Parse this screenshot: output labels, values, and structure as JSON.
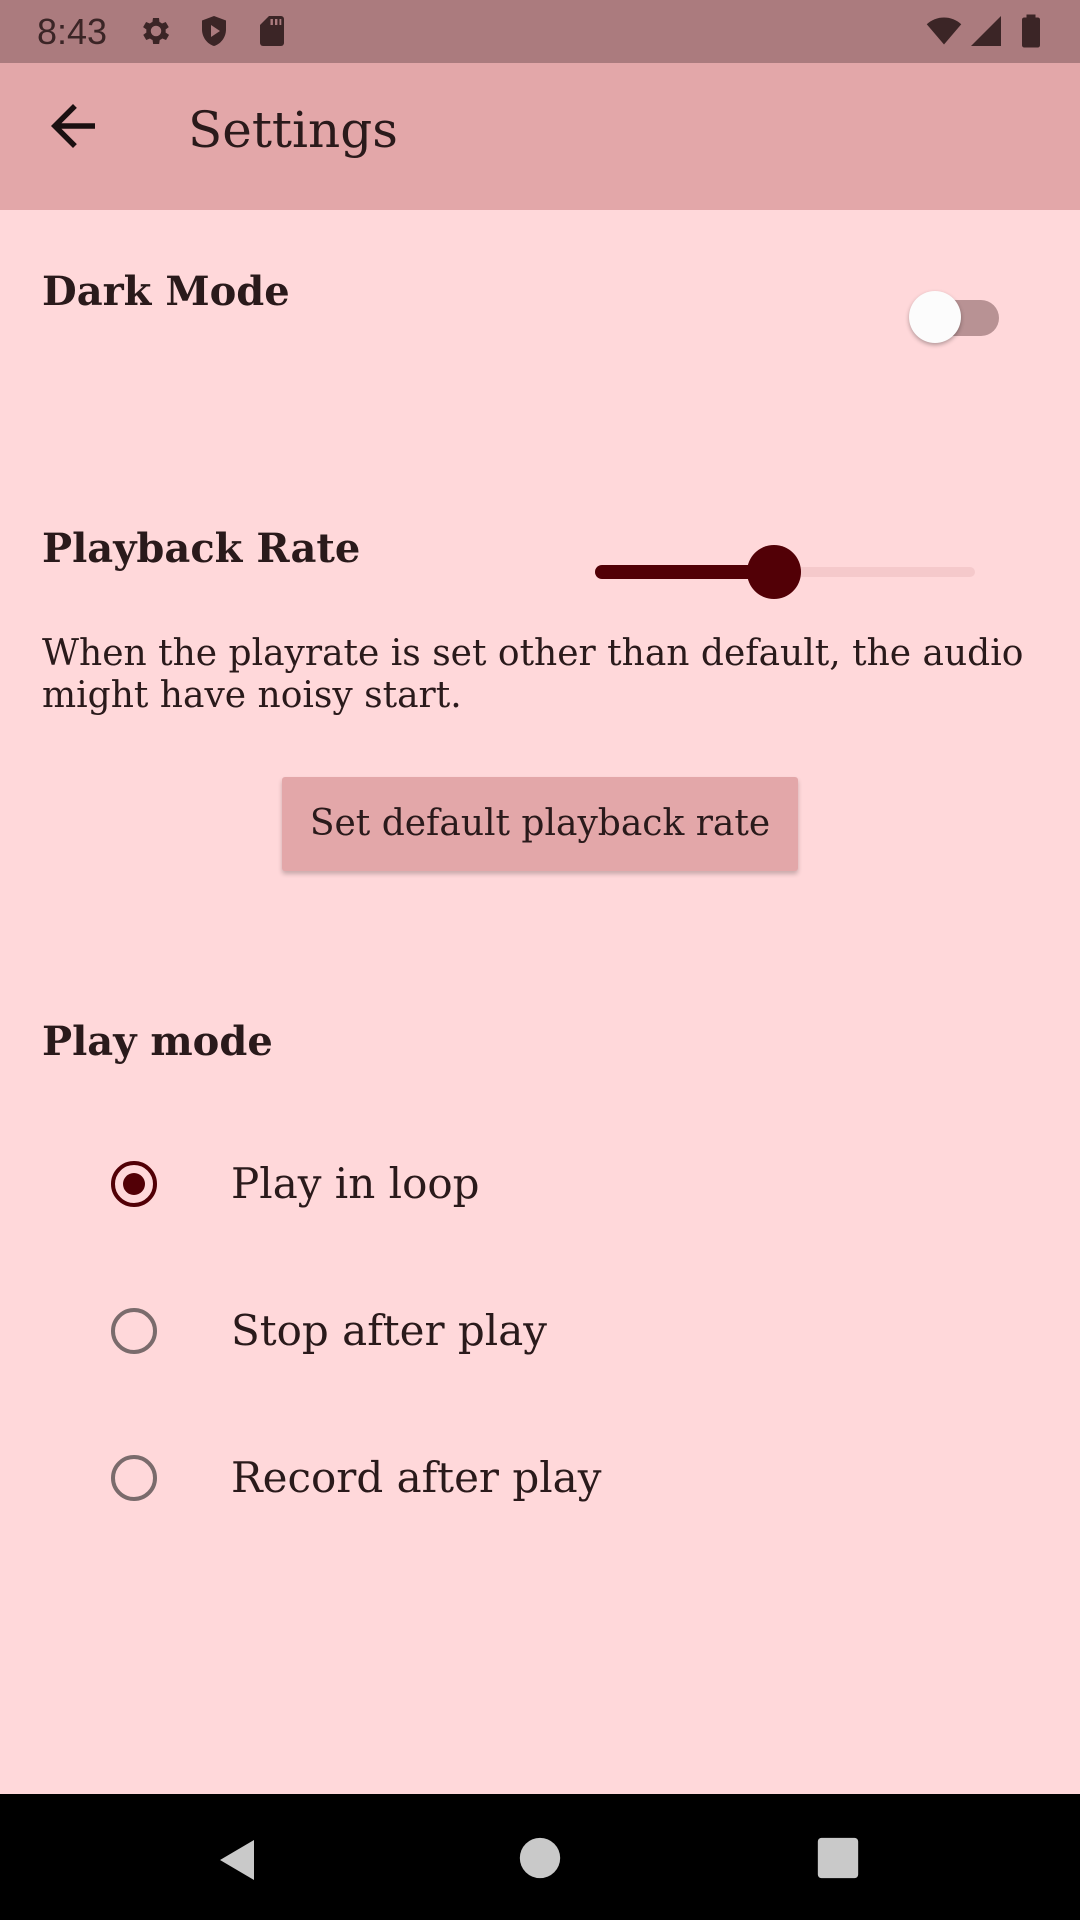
{
  "status_bar": {
    "time": "8:43",
    "left_icons": [
      "gear-icon",
      "shield-icon",
      "sd-card-icon"
    ],
    "right_icons": [
      "wifi-icon",
      "signal-icon",
      "battery-icon"
    ]
  },
  "app_bar": {
    "title": "Settings",
    "back_icon": "arrow-left-icon"
  },
  "dark_mode": {
    "label": "Dark Mode",
    "enabled": false
  },
  "playback_rate": {
    "label": "Playback Rate",
    "slider_fraction": 0.47,
    "note": "When the playrate is set other than default, the audio might have noisy start.",
    "reset_button": "Set default playback rate"
  },
  "play_mode": {
    "label": "Play mode",
    "options": [
      {
        "label": "Play in loop",
        "selected": true
      },
      {
        "label": "Stop after play",
        "selected": false
      },
      {
        "label": "Record after play",
        "selected": false
      }
    ]
  },
  "nav_bar": {
    "icons": [
      "back-triangle-icon",
      "home-circle-icon",
      "recents-square-icon"
    ]
  },
  "colors": {
    "background": "#ffd8da",
    "app_bar": "#e3a7a9",
    "status_bar": "#ab7b7e",
    "accent": "#520006"
  }
}
